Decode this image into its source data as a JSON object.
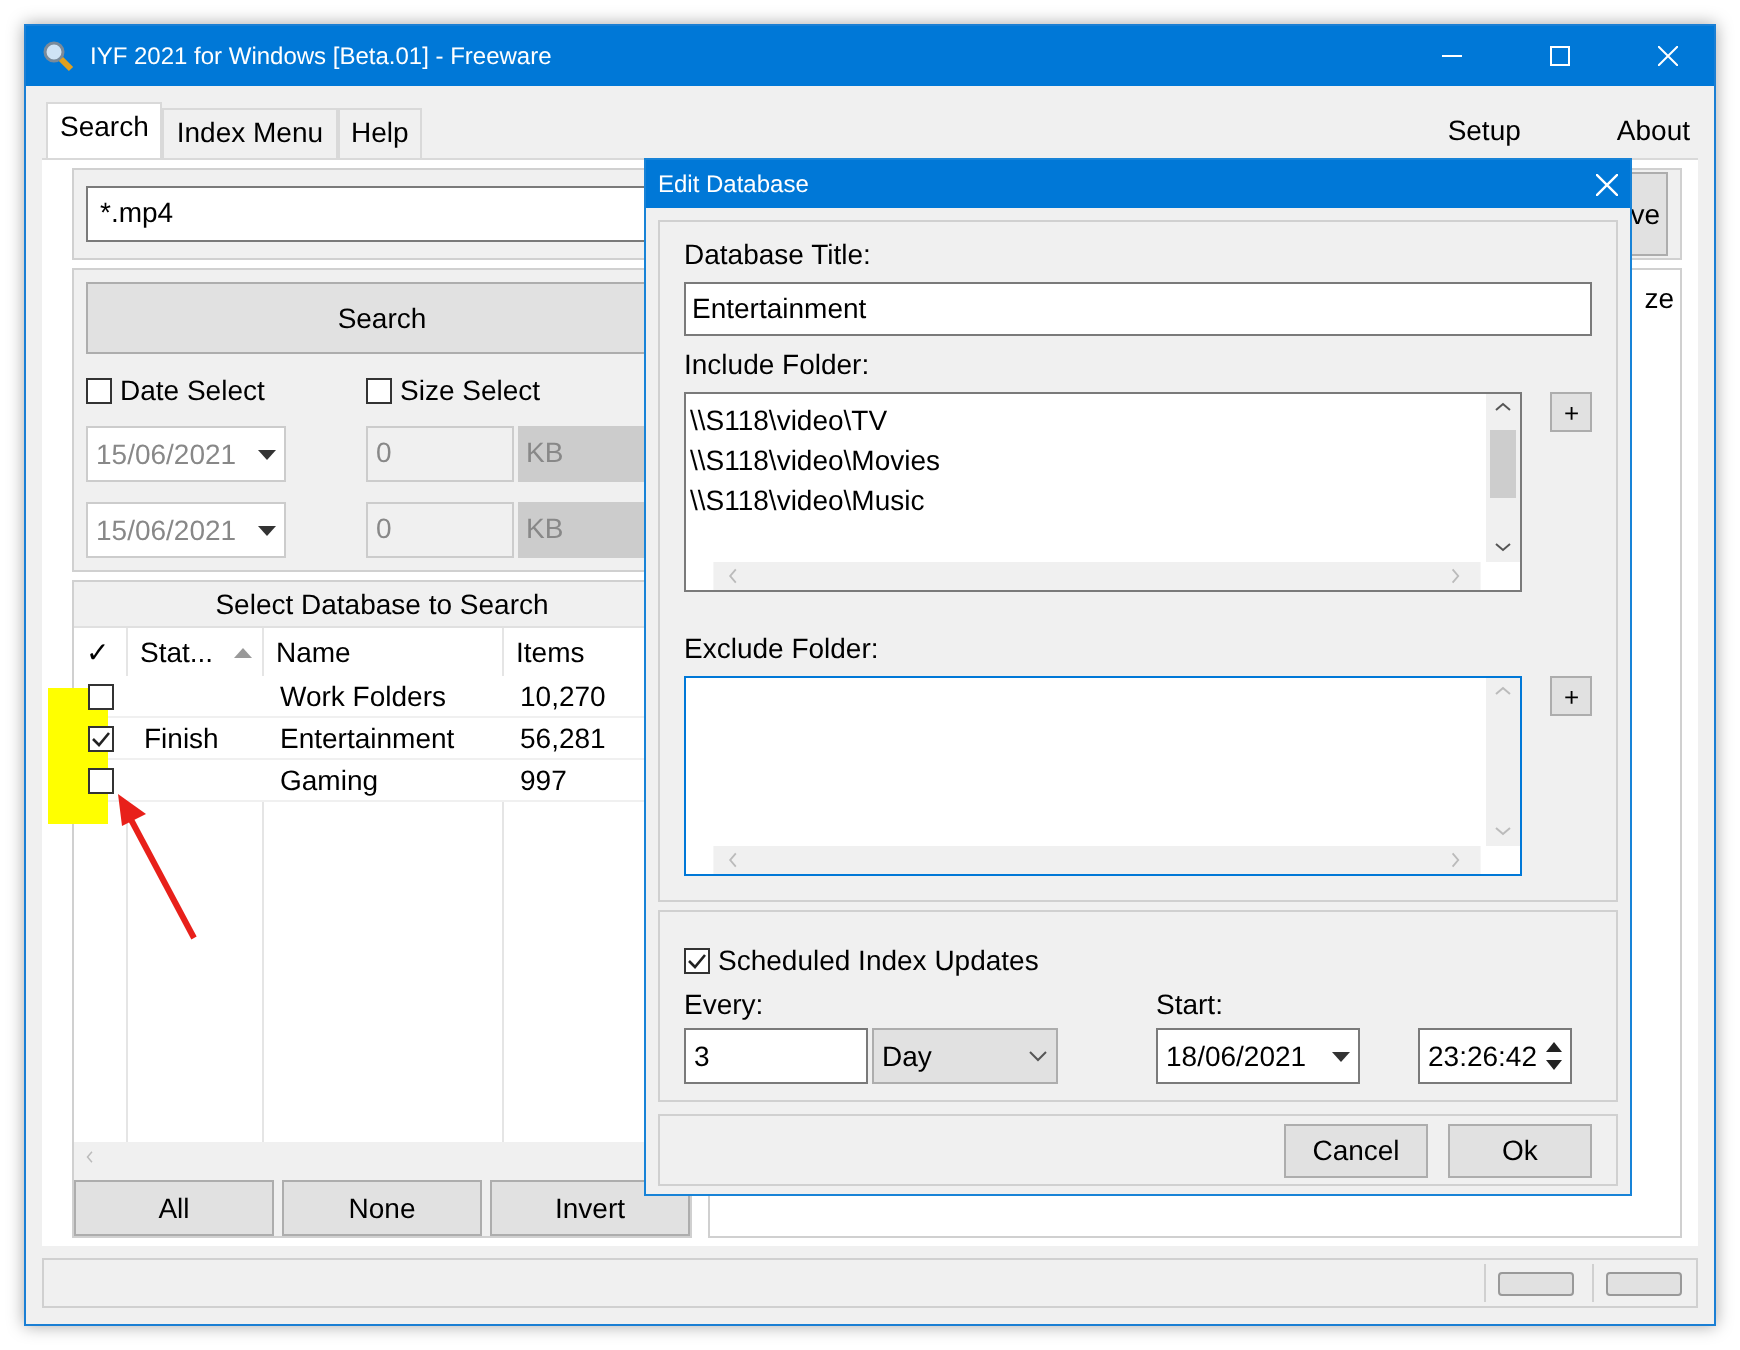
{
  "window": {
    "title": "IYF 2021 for Windows [Beta.01] - Freeware"
  },
  "tabs": [
    {
      "label": "Search",
      "selected": true
    },
    {
      "label": "Index Menu",
      "selected": false
    },
    {
      "label": "Help",
      "selected": false
    }
  ],
  "menu_right": [
    "Setup",
    "About"
  ],
  "search": {
    "value": "*.mp4"
  },
  "partial_button": "ve",
  "search_button": "Search",
  "filters": [
    {
      "label": "Date Select",
      "checked": false
    },
    {
      "label": "Size Select",
      "checked": false
    }
  ],
  "date_fields": [
    {
      "value": "15/06/2021",
      "disabled": true
    },
    {
      "value": "15/06/2021",
      "disabled": true
    }
  ],
  "size_fields": [
    {
      "value": "0",
      "unit": "KB",
      "disabled": true
    },
    {
      "value": "0",
      "unit": "KB",
      "disabled": true
    }
  ],
  "database_panel": {
    "title": "Select Database to Search",
    "columns": [
      "✓",
      "Stat...",
      "Name",
      "Items"
    ],
    "rows": [
      {
        "checked": false,
        "status": "",
        "name": "Work Folders",
        "items": "10,270"
      },
      {
        "checked": true,
        "status": "Finish",
        "name": "Entertainment",
        "items": "56,281"
      },
      {
        "checked": false,
        "status": "",
        "name": "Gaming",
        "items": "997"
      }
    ]
  },
  "selection_buttons": [
    "All",
    "None",
    "Invert"
  ],
  "right_column_partial": "ze",
  "dialog": {
    "title": "Edit Database",
    "title_label": "Database Title:",
    "title_value": "Entertainment",
    "include_label": "Include Folder:",
    "include_folders": [
      "\\\\S118\\video\\TV",
      "\\\\S118\\video\\Movies",
      "\\\\S118\\video\\Music"
    ],
    "exclude_label": "Exclude Folder:",
    "scheduled": {
      "label": "Scheduled Index Updates",
      "checked": true
    },
    "every_label": "Every:",
    "every_value": "3",
    "unit": "Day",
    "start_label": "Start:",
    "start_date": "18/06/2021",
    "start_time": "23:26:42",
    "add_buttons": [
      "+",
      "+"
    ],
    "buttons": [
      "Cancel",
      "Ok"
    ]
  }
}
